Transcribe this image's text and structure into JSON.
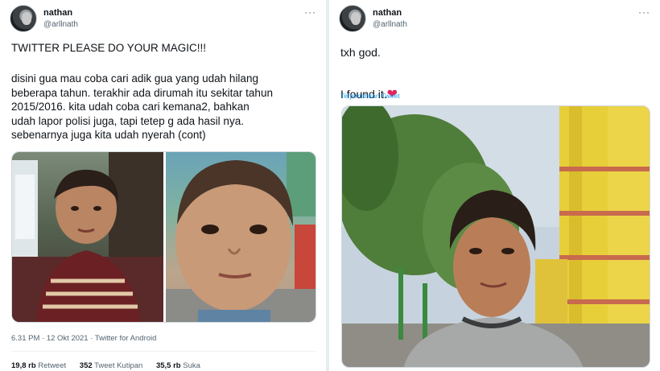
{
  "left_tweet": {
    "author_name": "nathan",
    "author_handle": "@arllnath",
    "more": "···",
    "headline": "TWITTER PLEASE DO YOUR MAGIC!!!",
    "text": "disini gua mau coba cari adik gua yang udah hilang\nbeberapa tahun. terakhir ada dirumah itu sekitar tahun\n2015/2016. kita udah coba cari kemana2, bahkan\nudah lapor polisi juga, tapi tetep g ada hasil nya.\nsebenarnya juga kita udah nyerah (cont)",
    "timestamp": "6.31 PM · 12 Okt 2021 · Twitter for Android",
    "stats": {
      "retweets_count": "19,8 rb",
      "retweets_label": "Retweet",
      "quotes_count": "352",
      "quotes_label": "Tweet Kutipan",
      "likes_count": "35,5 rb",
      "likes_label": "Suka"
    }
  },
  "right_tweet": {
    "author_name": "nathan",
    "author_handle": "@arllnath",
    "more": "···",
    "line1": "txh god.",
    "line2": "I found it.",
    "heart": "❤",
    "translate_label": "Terjemahkan Tweet"
  },
  "colors": {
    "link": "#1d9bf0",
    "secondary_text": "#536471",
    "heart": "#e0245e"
  }
}
